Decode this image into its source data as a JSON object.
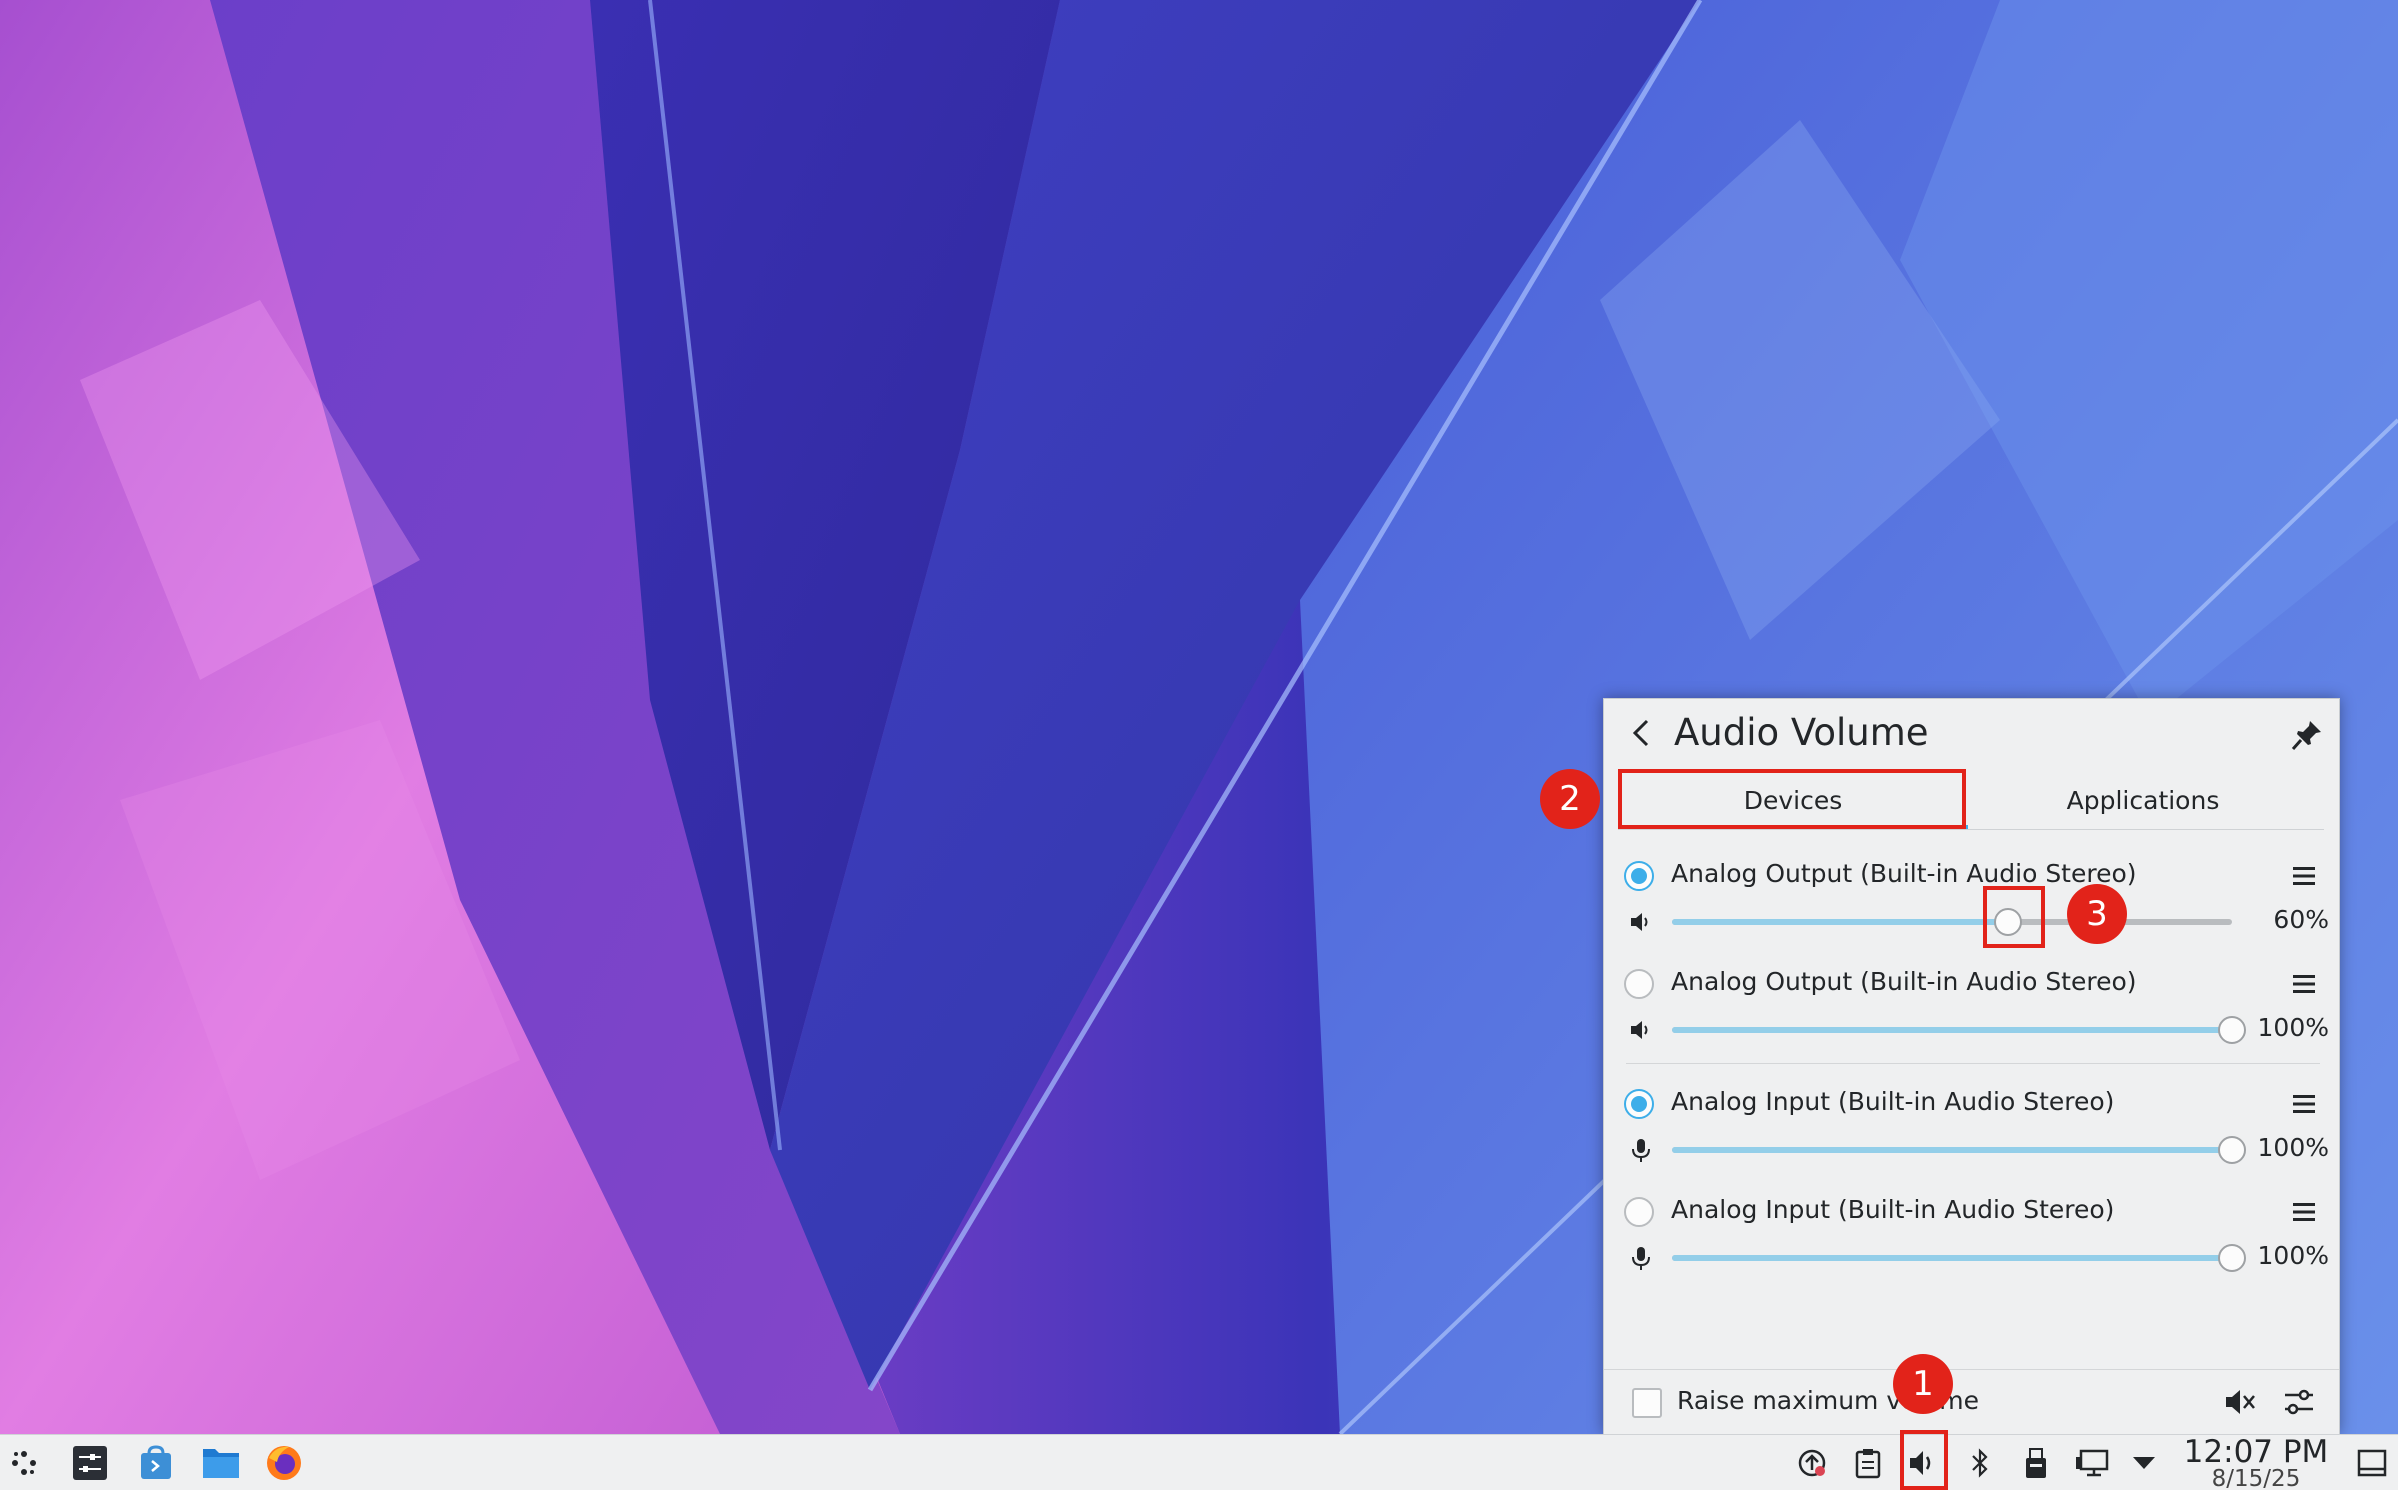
{
  "colors": {
    "accent": "#3daee9",
    "annotation": "#e2231a",
    "panel_bg": "#eff0f1"
  },
  "popup": {
    "title": "Audio Volume",
    "tabs": [
      {
        "label": "Devices",
        "active": true
      },
      {
        "label": "Applications",
        "active": false
      }
    ],
    "devices": [
      {
        "label": "Analog Output (Built-in Audio Stereo)",
        "kind": "output",
        "default": true,
        "volume": 60,
        "volume_label": "60%"
      },
      {
        "label": "Analog Output (Built-in Audio Stereo)",
        "kind": "output",
        "default": false,
        "volume": 100,
        "volume_label": "100%"
      },
      {
        "label": "Analog Input (Built-in Audio Stereo)",
        "kind": "input",
        "default": true,
        "volume": 100,
        "volume_label": "100%"
      },
      {
        "label": "Analog Input (Built-in Audio Stereo)",
        "kind": "input",
        "default": false,
        "volume": 100,
        "volume_label": "100%"
      }
    ],
    "footer": {
      "raise_max_label": "Raise maximum volume",
      "raise_max_checked": false
    }
  },
  "taskbar": {
    "launchers": [
      "application-launcher-icon",
      "system-settings-icon",
      "discover-icon",
      "dolphin-icon",
      "firefox-icon"
    ],
    "tray": [
      "updates-icon",
      "clipboard-icon",
      "volume-icon",
      "bluetooth-icon",
      "removable-device-icon",
      "network-icon",
      "expand-tray-icon"
    ],
    "clock": {
      "time": "12:07 PM",
      "date": "8/15/25"
    }
  },
  "annotations": [
    {
      "number": "1",
      "target": "taskbar volume icon"
    },
    {
      "number": "2",
      "target": "Devices tab"
    },
    {
      "number": "3",
      "target": "first output volume slider handle"
    }
  ]
}
